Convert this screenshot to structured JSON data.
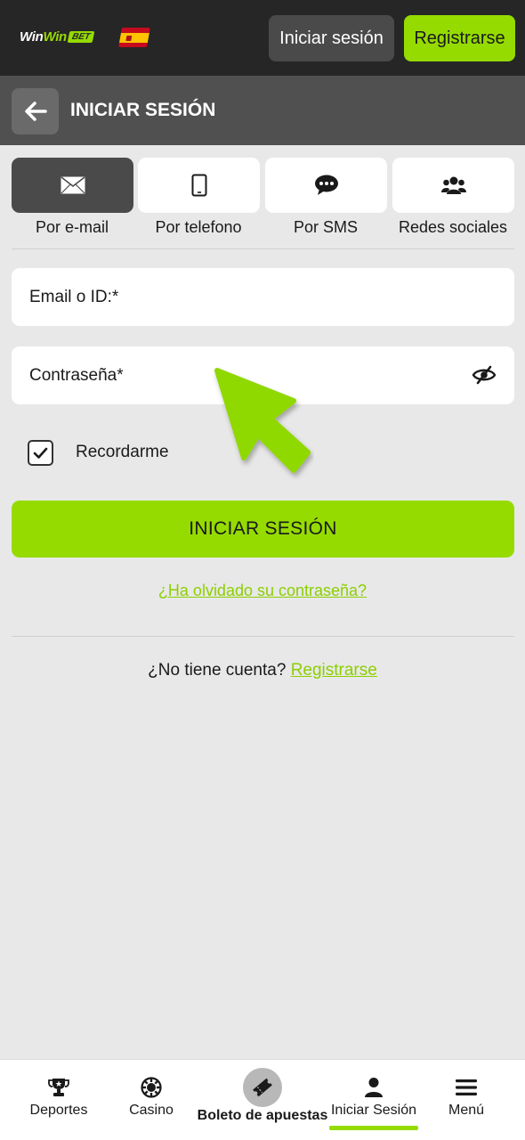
{
  "header": {
    "logo": {
      "part1": "Win",
      "part2": "Win",
      "badge": "BET"
    },
    "flag_icon": "spain-flag-icon",
    "login_label": "Iniciar sesión",
    "register_label": "Registrarse"
  },
  "subheader": {
    "back_icon": "arrow-left-icon",
    "title": "INICIAR SESIÓN"
  },
  "methods": [
    {
      "label": "Por e-mail",
      "icon": "envelope-icon",
      "active": true
    },
    {
      "label": "Por telefono",
      "icon": "phone-icon",
      "active": false
    },
    {
      "label": "Por SMS",
      "icon": "chat-bubble-icon",
      "active": false
    },
    {
      "label": "Redes sociales",
      "icon": "users-icon",
      "active": false
    }
  ],
  "form": {
    "email_label": "Email o ID:*",
    "email_value": "",
    "password_label": "Contraseña*",
    "password_value": "",
    "password_toggle_icon": "eye-slash-icon",
    "remember_label": "Recordarme",
    "remember_checked": true,
    "submit_label": "INICIAR SESIÓN",
    "forgot_label": "¿Ha olvidado su contraseña?",
    "no_account_label": "¿No tiene cuenta?",
    "register_link": "Registrarse"
  },
  "bottom_nav": [
    {
      "label": "Deportes",
      "icon": "trophy-icon"
    },
    {
      "label": "Casino",
      "icon": "casino-chip-icon"
    },
    {
      "label": "Boleto de apuestas",
      "icon": "ticket-icon"
    },
    {
      "label": "Iniciar Sesión",
      "icon": "user-icon",
      "active": true
    },
    {
      "label": "Menú",
      "icon": "hamburger-menu-icon"
    }
  ],
  "colors": {
    "accent": "#95db00",
    "header_bg": "#262626",
    "subheader_bg": "#505050",
    "page_bg": "#e8e8e8"
  }
}
